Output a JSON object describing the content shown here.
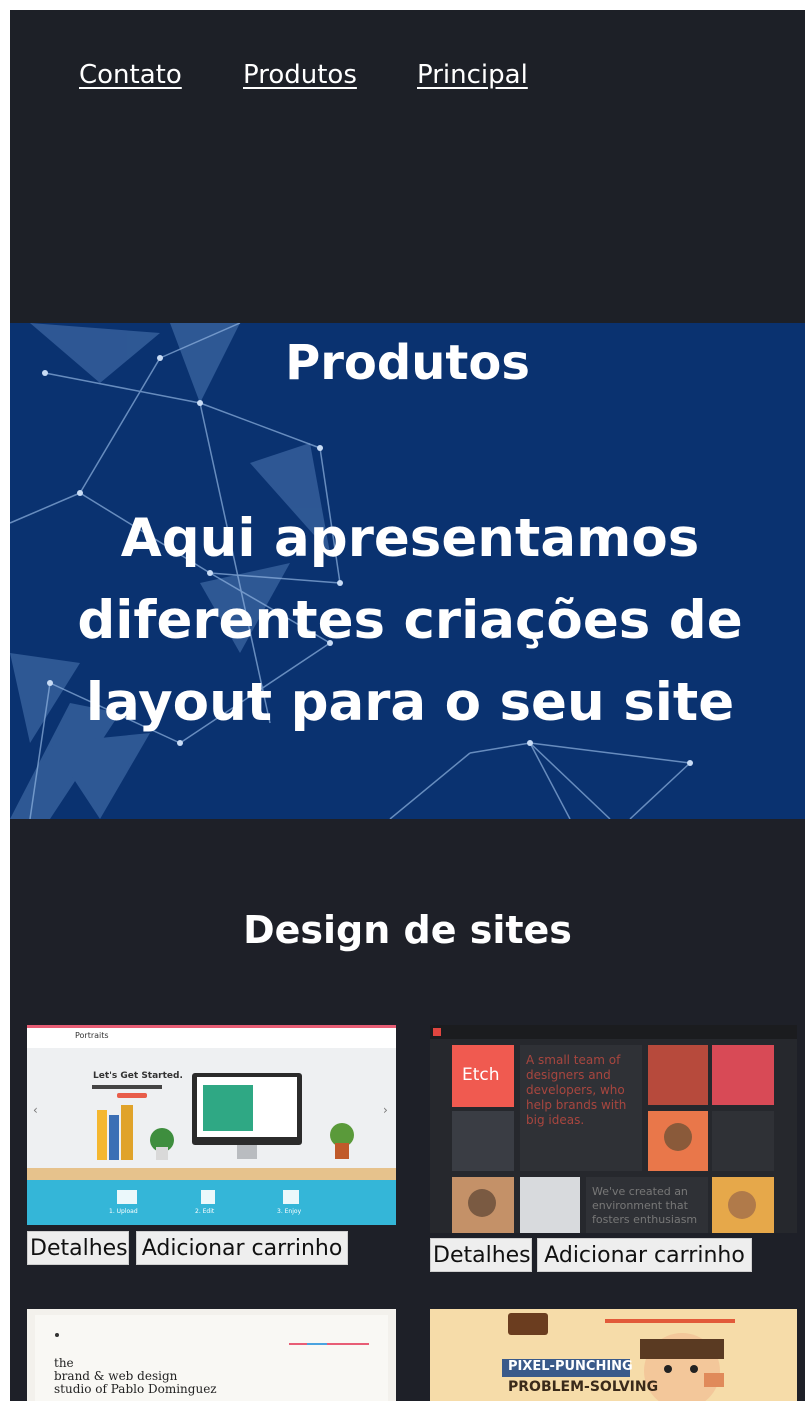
{
  "nav": {
    "links": [
      "Contato",
      "Produtos",
      "Principal"
    ]
  },
  "hero": {
    "title": "Produtos",
    "text": "Aqui apresentamos diferentes criações de layout para o seu site"
  },
  "section": {
    "title": "Design de sites"
  },
  "cards": [
    {
      "thumb": {
        "logo": "Portraits",
        "heading": "Let's Get Started.",
        "steps": [
          "1. Upload",
          "2. Edit",
          "3. Enjoy"
        ]
      },
      "details_label": "Detalhes",
      "cart_label": "Adicionar carrinho"
    },
    {
      "thumb": {
        "logo": "Etch",
        "text1": "A small team of designers and developers, who help brands with big ideas.",
        "text2": "We've created an environment that fosters enthusiasm"
      },
      "details_label": "Detalhes",
      "cart_label": "Adicionar carrinho"
    },
    {
      "thumb": {
        "line1": "the",
        "line2": "brand & web design",
        "line3": "studio of Pablo Dominguez"
      }
    },
    {
      "thumb": {
        "line1": "PIXEL-PUNCHING",
        "line2": "PROBLEM-SOLVING"
      }
    }
  ],
  "colors": {
    "page_bg": "#1e2028",
    "hero_bg": "#0a3270",
    "button_bg": "#eeeeee"
  }
}
